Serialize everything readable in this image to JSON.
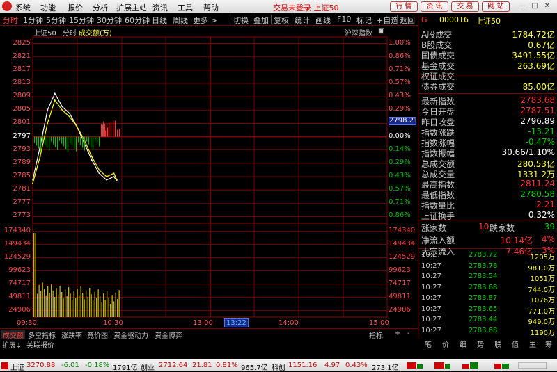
{
  "menubar": {
    "items": [
      "系统",
      "功能",
      "报价",
      "分析",
      "扩展主站",
      "资讯",
      "工具",
      "帮助"
    ],
    "status": "交易未登录 上证50",
    "buttons": [
      "行 情",
      "资 讯",
      "交 易",
      "网 站"
    ]
  },
  "toolbar": {
    "periods": [
      "分时",
      "1分钟",
      "5分钟",
      "15分钟",
      "30分钟",
      "60分钟",
      "日线",
      "周线",
      "更多 >"
    ],
    "actions": [
      "切换",
      "叠加",
      "复权",
      "统计",
      "画线",
      "F10",
      "标记",
      "+自选",
      "返回"
    ]
  },
  "chart": {
    "header": {
      "name": "上证50",
      "mode": "分时",
      "indicator": "成交额(万)",
      "right": "沪深指数"
    },
    "price_ticks_left": [
      "2825",
      "2821",
      "2817",
      "2813",
      "2809",
      "2805",
      "2801",
      "2797",
      "2793",
      "2789",
      "2785",
      "2781",
      "2777",
      "2773"
    ],
    "pct_ticks_right": [
      "1.00%",
      "0.86%",
      "0.71%",
      "0.57%",
      "0.43%",
      "0.29%",
      "0.14%",
      "0.00%",
      "0.14%",
      "0.29%",
      "0.43%",
      "0.57%",
      "0.71%",
      "0.86%"
    ],
    "current_price_label": "2798.21",
    "volume_ticks_left": [
      "174340",
      "149434",
      "124529",
      "99623",
      "74717",
      "49811",
      "24906"
    ],
    "volume_ticks_right": [
      "174340",
      "149434",
      "124529",
      "99623",
      "74717",
      "49811",
      "24906"
    ],
    "time_labels": [
      "09:30",
      "10:30",
      "13:00",
      "13:22",
      "14:00",
      "15:00"
    ],
    "colors": {
      "grid": "#8b0000",
      "price_line": "#ffffff",
      "avg_line": "#ffff00",
      "up": "#ff3030",
      "down": "#00c000",
      "volume": "#c8b400"
    }
  },
  "chart_data": {
    "type": "line",
    "x": [
      "09:30",
      "09:35",
      "09:40",
      "09:45",
      "09:50",
      "09:55",
      "10:00",
      "10:05",
      "10:10",
      "10:15",
      "10:20",
      "10:25",
      "10:27"
    ],
    "series": [
      {
        "values": [
          2784,
          2794,
          2805,
          2810,
          2806,
          2804,
          2800,
          2795,
          2790,
          2786,
          2784,
          2785,
          2783.7
        ]
      },
      {
        "values": [
          2783,
          2791,
          2801,
          2808,
          2805,
          2803,
          2800,
          2796,
          2791,
          2787,
          2785,
          2786,
          2784
        ]
      }
    ],
    "ylim": [
      2771,
      2827
    ]
  },
  "bottom_tabs": [
    "成交额",
    "多空指标",
    "涨跌率",
    "竟价图",
    "资金驱动力",
    "资金博弈",
    "指标",
    "+",
    "-"
  ],
  "extra_row": [
    "扩展↓",
    "关联报价"
  ],
  "right_panel": {
    "summary": [
      {
        "label": "A股成交",
        "value": "1784.72亿"
      },
      {
        "label": "B股成交",
        "value": "0.67亿"
      },
      {
        "label": "国债成交",
        "value": "3491.55亿"
      },
      {
        "label": "基金成交",
        "value": "263.69亿"
      },
      {
        "label": "权证成交",
        "value": ""
      },
      {
        "label": "债券成交",
        "value": "85.00亿"
      }
    ],
    "code_line": {
      "g": "G",
      "code": "000016",
      "name": "上证50"
    },
    "stats": [
      {
        "label": "最新指数",
        "value": "2783.68"
      },
      {
        "label": "今日开盘",
        "value": "2787.51"
      },
      {
        "label": "昨日收盘",
        "value": "2796.89"
      },
      {
        "label": "指数涨跌",
        "value": "-13.21"
      },
      {
        "label": "指数涨幅",
        "value": "-0.47%"
      },
      {
        "label": "指数振幅",
        "value": "30.66/1.10%"
      },
      {
        "label": "总成交额",
        "value": "280.53亿"
      },
      {
        "label": "总成交量",
        "value": "1331.2万"
      },
      {
        "label": "最高指数",
        "value": "2811.24"
      },
      {
        "label": "最低指数",
        "value": "2780.58"
      },
      {
        "label": "指数量比",
        "value": "2.21"
      },
      {
        "label": "上证换手",
        "value": "0.32%"
      }
    ],
    "updown": {
      "up_label": "涨家数",
      "up": "10",
      "down_label": "跌家数",
      "down": "39"
    },
    "flows": [
      {
        "label": "净流入额",
        "value": "10.14亿",
        "pct": "4%"
      },
      {
        "label": "大宗流入",
        "value": "7.46亿",
        "pct": "3%"
      }
    ],
    "ticks": [
      {
        "time": "10:27",
        "price": "2783.72",
        "vol": "1205万"
      },
      {
        "time": "10:27",
        "price": "2783.78",
        "vol": "981.0万"
      },
      {
        "time": "10:27",
        "price": "2783.54",
        "vol": "1051万"
      },
      {
        "time": "10:27",
        "price": "2783.68",
        "vol": "744.0万"
      },
      {
        "time": "10:27",
        "price": "2783.87",
        "vol": "1076万"
      },
      {
        "time": "10:27",
        "price": "2783.65",
        "vol": "771.0万"
      },
      {
        "time": "10:27",
        "price": "2783.44",
        "vol": "949.0万"
      },
      {
        "time": "10:27",
        "price": "2783.68",
        "vol": "1190万"
      }
    ],
    "nav": [
      "笔",
      "价",
      "细",
      "势",
      "联",
      "值",
      "主",
      "筹"
    ]
  },
  "statusbar": {
    "items": [
      {
        "name": "上证",
        "value": "3270.88",
        "chg": "-6.01",
        "pct": "-0.18%",
        "amt": "1791亿"
      },
      {
        "name": "创业",
        "value": "2712.64",
        "chg": "21.81",
        "pct": "0.81%",
        "amt": "965.7亿"
      },
      {
        "name": "科创",
        "value": "1151.16",
        "chg": "4.97",
        "pct": "0.43%",
        "amt": "273.1亿"
      }
    ]
  }
}
